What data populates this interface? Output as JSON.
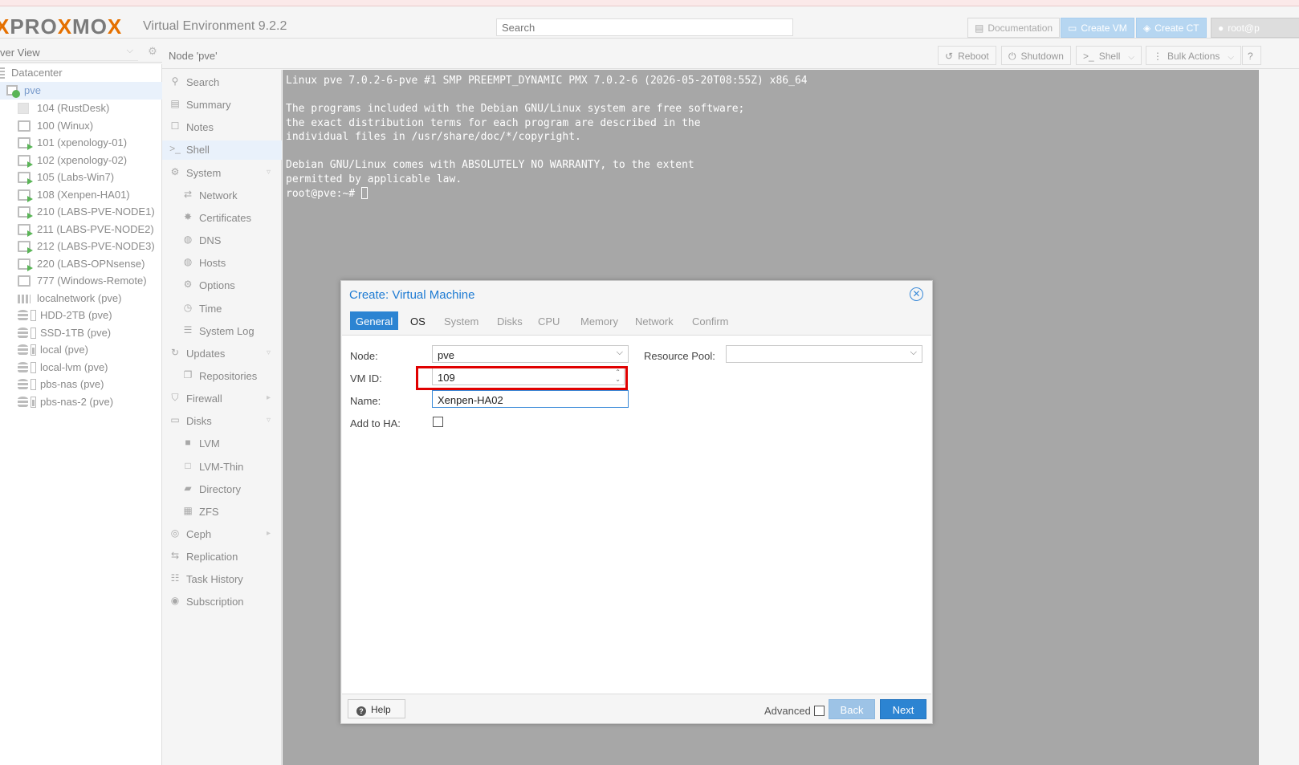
{
  "header": {
    "logo_left": "PRO",
    "logo_x1": "X",
    "logo_mid": "MO",
    "logo_x2": "X",
    "product": "Virtual Environment 9.2.2",
    "search_placeholder": "Search",
    "buttons": {
      "documentation": "Documentation",
      "create_vm": "Create VM",
      "create_ct": "Create CT",
      "user": "root@p"
    }
  },
  "tree": {
    "view_label": "ver View",
    "root": "Datacenter",
    "node": "pve",
    "items": [
      {
        "label": "104 (RustDesk)",
        "type": "ct"
      },
      {
        "label": "100 (Winux)",
        "type": "vm"
      },
      {
        "label": "101 (xpenology-01)",
        "type": "vm-run"
      },
      {
        "label": "102 (xpenology-02)",
        "type": "vm-run"
      },
      {
        "label": "105 (Labs-Win7)",
        "type": "vm-run"
      },
      {
        "label": "108 (Xenpen-HA01)",
        "type": "vm-run"
      },
      {
        "label": "210 (LABS-PVE-NODE1)",
        "type": "vm-run"
      },
      {
        "label": "211 (LABS-PVE-NODE2)",
        "type": "vm-run"
      },
      {
        "label": "212 (LABS-PVE-NODE3)",
        "type": "vm-run"
      },
      {
        "label": "220 (LABS-OPNsense)",
        "type": "vm-run"
      },
      {
        "label": "777 (Windows-Remote)",
        "type": "vm"
      },
      {
        "label": "localnetwork (pve)",
        "type": "network"
      },
      {
        "label": "HDD-2TB (pve)",
        "type": "storage"
      },
      {
        "label": "SSD-1TB (pve)",
        "type": "storage"
      },
      {
        "label": "local (pve)",
        "type": "storage-fill"
      },
      {
        "label": "local-lvm (pve)",
        "type": "storage"
      },
      {
        "label": "pbs-nas (pve)",
        "type": "storage"
      },
      {
        "label": "pbs-nas-2 (pve)",
        "type": "storage-fill"
      }
    ]
  },
  "node_bar": {
    "title": "Node 'pve'",
    "reboot": "Reboot",
    "shutdown": "Shutdown",
    "shell": "Shell",
    "bulk_actions": "Bulk Actions"
  },
  "node_menu": [
    {
      "label": "Search",
      "icon": "search-icon",
      "glyph": "⚲"
    },
    {
      "label": "Summary",
      "icon": "book-icon",
      "glyph": "▤"
    },
    {
      "label": "Notes",
      "icon": "note-icon",
      "glyph": "☐"
    },
    {
      "label": "Shell",
      "icon": "terminal-icon",
      "glyph": ">_"
    },
    {
      "label": "System",
      "icon": "gears-icon",
      "glyph": "⚙"
    },
    {
      "label": "Network",
      "icon": "exchange-icon",
      "glyph": "⇄"
    },
    {
      "label": "Certificates",
      "icon": "certificate-icon",
      "glyph": "✸"
    },
    {
      "label": "DNS",
      "icon": "globe-icon",
      "glyph": "◍"
    },
    {
      "label": "Hosts",
      "icon": "globe-icon",
      "glyph": "◍"
    },
    {
      "label": "Options",
      "icon": "gear-icon",
      "glyph": "⚙"
    },
    {
      "label": "Time",
      "icon": "clock-icon",
      "glyph": "◷"
    },
    {
      "label": "System Log",
      "icon": "list-icon",
      "glyph": "☰"
    },
    {
      "label": "Updates",
      "icon": "refresh-icon",
      "glyph": "↻"
    },
    {
      "label": "Repositories",
      "icon": "files-icon",
      "glyph": "❐"
    },
    {
      "label": "Firewall",
      "icon": "shield-icon",
      "glyph": "⛉"
    },
    {
      "label": "Disks",
      "icon": "hdd-icon",
      "glyph": "▭"
    },
    {
      "label": "LVM",
      "icon": "square-icon",
      "glyph": "■"
    },
    {
      "label": "LVM-Thin",
      "icon": "square-outline-icon",
      "glyph": "□"
    },
    {
      "label": "Directory",
      "icon": "folder-icon",
      "glyph": "▰"
    },
    {
      "label": "ZFS",
      "icon": "th-large-icon",
      "glyph": "▦"
    },
    {
      "label": "Ceph",
      "icon": "ceph-icon",
      "glyph": "◎"
    },
    {
      "label": "Replication",
      "icon": "retweet-icon",
      "glyph": "⇆"
    },
    {
      "label": "Task History",
      "icon": "list-alt-icon",
      "glyph": "☷"
    },
    {
      "label": "Subscription",
      "icon": "support-icon",
      "glyph": "◉"
    }
  ],
  "shell": {
    "lines": [
      "Linux pve 7.0.2-6-pve #1 SMP PREEMPT_DYNAMIC PMX 7.0.2-6 (2026-05-20T08:55Z) x86_64",
      "",
      "The programs included with the Debian GNU/Linux system are free software;",
      "the exact distribution terms for each program are described in the",
      "individual files in /usr/share/doc/*/copyright.",
      "",
      "Debian GNU/Linux comes with ABSOLUTELY NO WARRANTY, to the extent",
      "permitted by applicable law."
    ],
    "prompt": "root@pve:~# "
  },
  "modal": {
    "title": "Create: Virtual Machine",
    "tabs": [
      "General",
      "OS",
      "System",
      "Disks",
      "CPU",
      "Memory",
      "Network",
      "Confirm"
    ],
    "form": {
      "node_label": "Node:",
      "node_value": "pve",
      "vmid_label": "VM ID:",
      "vmid_value": "109",
      "name_label": "Name:",
      "name_value": "Xenpen-HA02",
      "ha_label": "Add to HA:",
      "pool_label": "Resource Pool:",
      "pool_value": ""
    },
    "footer": {
      "help": "Help",
      "advanced": "Advanced",
      "back": "Back",
      "next": "Next"
    }
  }
}
